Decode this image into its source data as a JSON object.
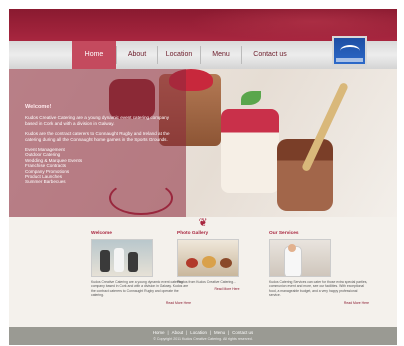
{
  "nav": {
    "items": [
      "Home",
      "About",
      "Location",
      "Menu",
      "Contact us"
    ],
    "active": "Home"
  },
  "hero": {
    "title": "Welcome!",
    "paragraph1": "Kudos Creative Catering are a young dynamic event catering company based in Cork and with a division in Galway.",
    "paragraph2": "Kudos are the contract caterers to Connaught Rugby and Ireland at the catering during all the Connaught home games in the Sports Grounds.",
    "services": [
      "Event Management",
      "Outdoor Catering",
      "Wedding & Marquee Events",
      "Franchise Contracts",
      "Company Promotions",
      "Product Launches",
      "Summer Barbecues"
    ]
  },
  "columns": [
    {
      "title": "Welcome",
      "text": "Kudos Creative Catering are a young dynamic event catering company based in Cork and with a division in Galway. Kudos are the contract caterers to Connaught Rugby and operate the catering.",
      "more": "Read More Here"
    },
    {
      "title": "Photo Gallery",
      "text": "Photos from Kudos Creative Catering...",
      "more": "Read More Here"
    },
    {
      "title": "Our Services",
      "text": "Kudos Catering Services can cater for those extra special parties, communion event and more, see our facilities. With exceptional food, a manageable budget, and a very happy professional service.",
      "more": "Read More Here"
    }
  ],
  "footer": {
    "links": [
      "Home",
      "About",
      "Location",
      "Menu",
      "Contact us"
    ],
    "copyright": "© Copyright 2011 Kudos Creative Catering. All rights reserved."
  },
  "colors": {
    "brand": "#a8263f",
    "nav_active": "#c44a5e",
    "footer": "#9a9a93"
  }
}
